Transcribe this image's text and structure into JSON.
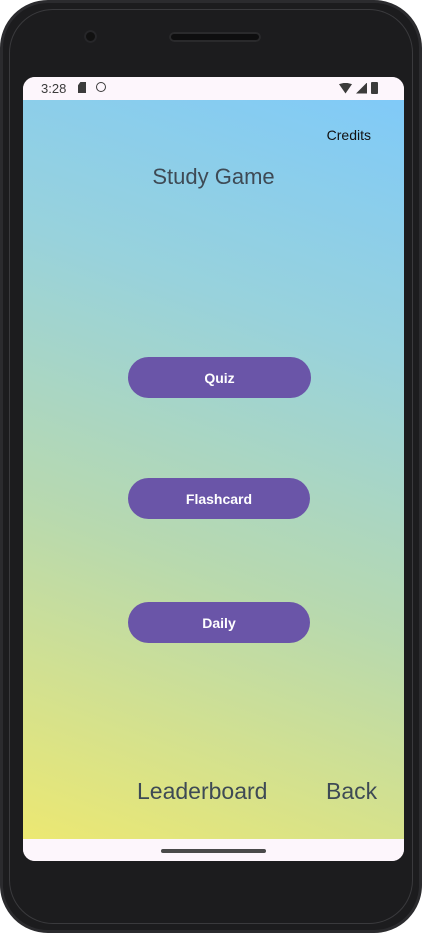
{
  "status_bar": {
    "time": "3:28",
    "left_icons": [
      "sd-card-icon",
      "face-icon"
    ],
    "right_icons": [
      "wifi-icon",
      "signal-icon",
      "battery-icon"
    ]
  },
  "app": {
    "credits_label": "Credits",
    "title": "Study Game",
    "buttons": {
      "quiz": "Quiz",
      "flashcard": "Flashcard",
      "daily": "Daily"
    },
    "bottom": {
      "leaderboard": "Leaderboard",
      "back": "Back"
    }
  },
  "colors": {
    "button_fill": "#6a55a8",
    "gradient_top": "#80caf8",
    "gradient_bottom": "#ece872"
  }
}
